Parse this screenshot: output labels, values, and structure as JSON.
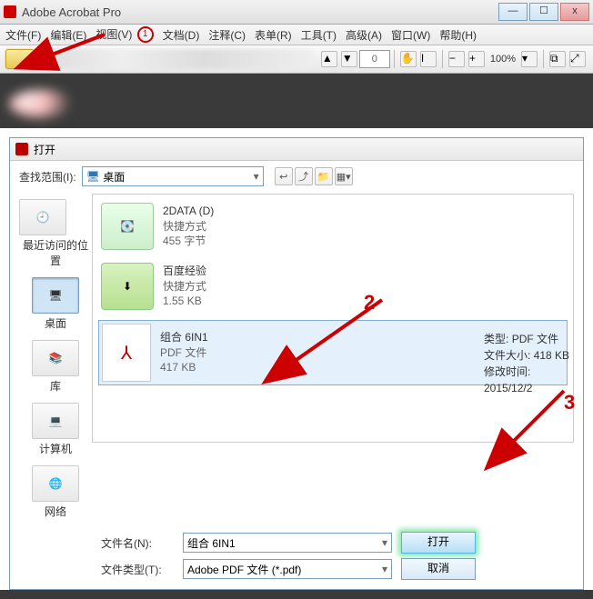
{
  "app": {
    "title": "Adobe Acrobat Pro"
  },
  "menu": {
    "file": "文件(F)",
    "edit": "编辑(E)",
    "view": "视图(V)",
    "doc": "文档(D)",
    "comment": "注释(C)",
    "form": "表单(R)",
    "tool": "工具(T)",
    "adv": "高级(A)",
    "window": "窗口(W)",
    "help": "帮助(H)"
  },
  "toolbar": {
    "page": "0",
    "zoom": "100%"
  },
  "annot": {
    "one": "1",
    "two": "2",
    "three": "3"
  },
  "dialog": {
    "title": "打开",
    "look_label": "查找范围(I):",
    "location": "桌面",
    "sidebar": [
      {
        "label": "最近访问的位置"
      },
      {
        "label": "桌面"
      },
      {
        "label": "库"
      },
      {
        "label": "计算机"
      },
      {
        "label": "网络"
      }
    ],
    "files": [
      {
        "name": "2DATA (D)",
        "meta1": "快捷方式",
        "meta2": "455 字节"
      },
      {
        "name": "百度经验",
        "meta1": "快捷方式",
        "meta2": "1.55 KB"
      },
      {
        "name": "组合 6IN1",
        "meta1": "PDF 文件",
        "meta2": "417 KB"
      }
    ],
    "info": {
      "type_label": "类型:",
      "type": "PDF 文件",
      "size_label": "文件大小:",
      "size": "418 KB",
      "mod_label": "修改时间:",
      "mod": "2015/12/2"
    },
    "filename_label": "文件名(N):",
    "filename": "组合 6IN1",
    "filetype_label": "文件类型(T):",
    "filetype": "Adobe PDF 文件 (*.pdf)",
    "open_btn": "打开",
    "cancel_btn": "取消"
  }
}
